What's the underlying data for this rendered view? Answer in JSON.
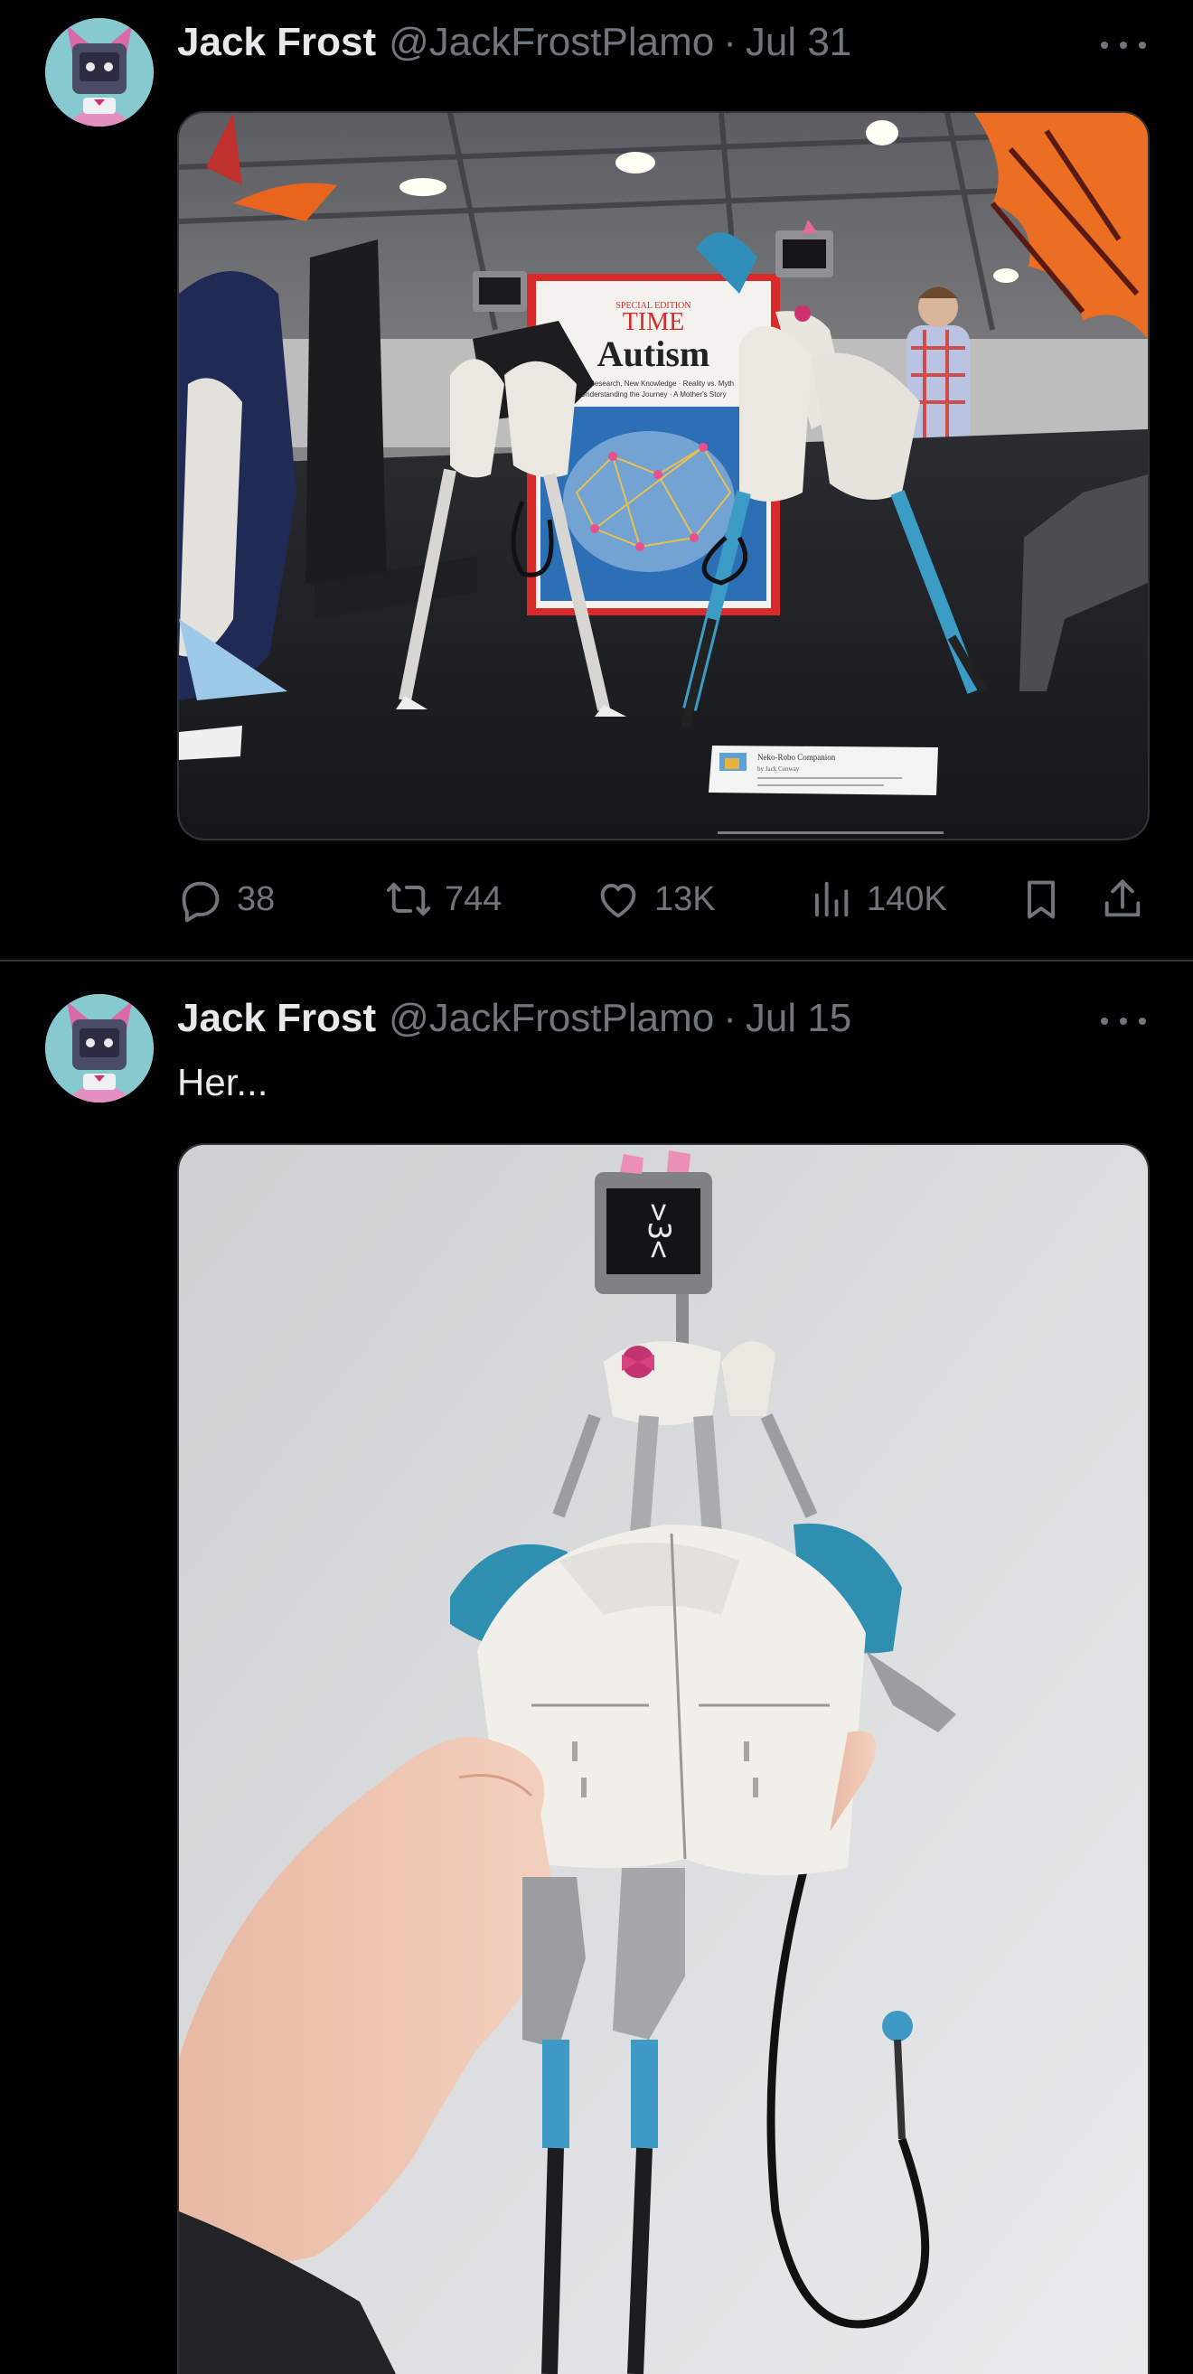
{
  "tweets": [
    {
      "author": {
        "name": "Jack Frost",
        "handle": "@JackFrostPlamo",
        "avatar_icon": "avatar-robot-cat-icon"
      },
      "separator": "·",
      "date": "Jul 31",
      "text": "",
      "media": {
        "magazine_title": "TIME",
        "magazine_headline": "Autism",
        "magazine_kicker": "SPECIAL EDITION",
        "magazine_subline_1": "New Research, New Knowledge · Reality vs. Myth",
        "magazine_subline_2": "Understanding the Journey · A Mother's Story",
        "display_card_title": "Neko-Robo Companion",
        "display_card_author": "by Jack Conway"
      },
      "stats": {
        "replies": "38",
        "reposts": "744",
        "likes": "13K",
        "views": "140K"
      }
    },
    {
      "author": {
        "name": "Jack Frost",
        "handle": "@JackFrostPlamo",
        "avatar_icon": "avatar-robot-cat-icon"
      },
      "separator": "·",
      "date": "Jul 15",
      "text": "Her...",
      "media": {
        "screen_face": ">3<"
      }
    }
  ],
  "colors": {
    "background": "#000000",
    "primary_text": "#e7e9ea",
    "secondary_text": "#71767b",
    "divider": "#2f3336"
  },
  "icons": [
    "more-icon",
    "reply-icon",
    "repost-icon",
    "like-icon",
    "views-icon",
    "bookmark-icon",
    "share-icon"
  ]
}
